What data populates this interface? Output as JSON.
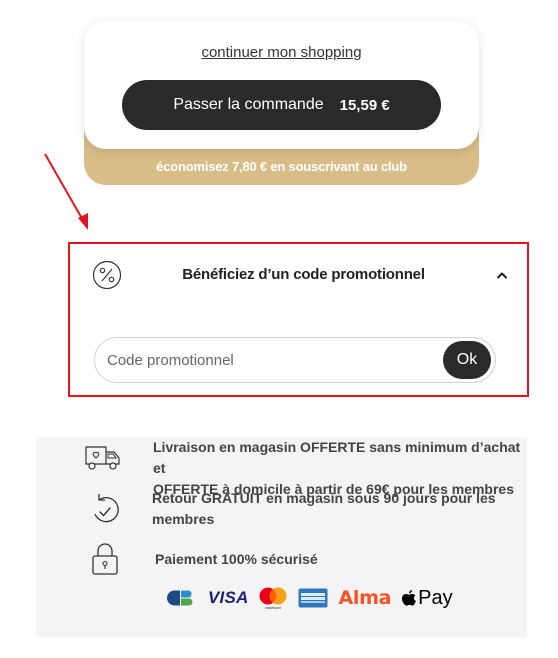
{
  "cart": {
    "continue_link": "continuer mon shopping",
    "checkout_label": "Passer la commande",
    "checkout_price": "15,59 €",
    "club_message": "économisez 7,80 € en souscrivant au club"
  },
  "promo": {
    "title": "Bénéficiez d’un code promotionnel",
    "placeholder": "Code promotionnel",
    "ok_label": "Ok",
    "icon": "percent-icon"
  },
  "reassurance": {
    "items": [
      {
        "icon": "delivery-truck-icon",
        "text_line1": "Livraison en magasin OFFERTE sans minimum d’achat et",
        "text_line2": "OFFERTE à domicile à partir de 69€ pour les membres"
      },
      {
        "icon": "return-icon",
        "text_line1": "Retour GRATUIT en magasin sous 90 jours pour les",
        "text_line2": "membres"
      },
      {
        "icon": "padlock-icon",
        "text_line1": "Paiement 100% sécurisé",
        "text_line2": ""
      }
    ],
    "payments": {
      "visa": "VISA",
      "mastercard_caption": "mastercard",
      "alma": "Alma",
      "applepay": "Pay"
    }
  },
  "colors": {
    "accent_gold": "#d8bd88",
    "button_dark": "#2a2a2a",
    "annotation_red": "#e5141c"
  }
}
